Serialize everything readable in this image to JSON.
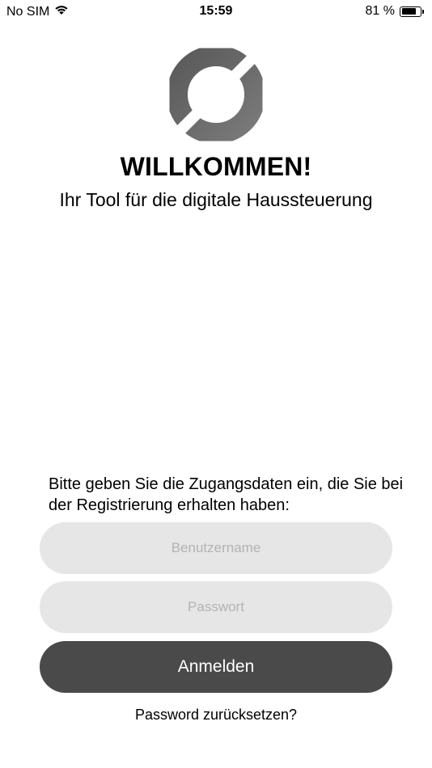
{
  "status_bar": {
    "carrier": "No SIM",
    "time": "15:59",
    "battery": "81 %",
    "battery_level": 0.81,
    "wifi_icon": "wifi-icon",
    "battery_icon": "battery-icon"
  },
  "header": {
    "logo_icon": "app-logo-icon",
    "title": "WILLKOMMEN!",
    "subtitle": "Ihr Tool für die digitale Haussteuerung"
  },
  "login": {
    "instructions": "Bitte geben Sie die Zugangsdaten ein, die Sie bei der Registrierung erhalten haben:",
    "username_placeholder": "Benutzername",
    "username_value": "",
    "password_placeholder": "Passwort",
    "password_value": "",
    "submit_label": "Anmelden",
    "reset_link": "Password zurücksetzen?"
  },
  "colors": {
    "logo_gray": "#6b6b6b",
    "field_bg": "#e6e6e6",
    "button_bg": "#4a4a4a",
    "button_text": "#ffffff"
  }
}
